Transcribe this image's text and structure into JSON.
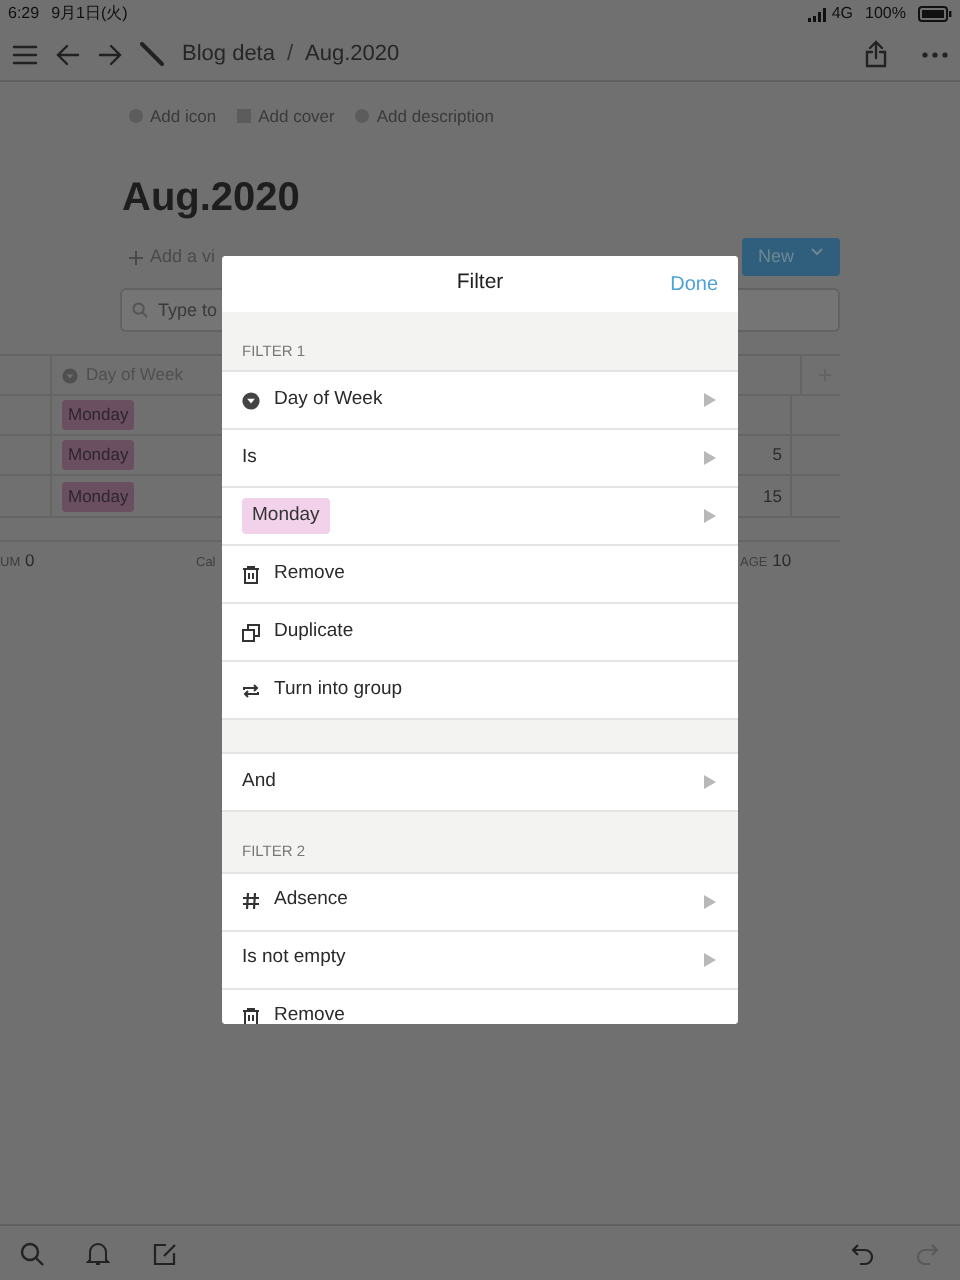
{
  "status_bar": {
    "time": "6:29",
    "date": "9月1日(火)",
    "network": "4G",
    "battery": "100%"
  },
  "nav": {
    "breadcrumb": [
      "Blog deta",
      "Aug.2020"
    ],
    "separator": "/"
  },
  "page_actions": [
    "Add icon",
    "Add cover",
    "Add description"
  ],
  "title": "Aug.2020",
  "view_bar": {
    "add_view": "Add a vi",
    "new_button": "New"
  },
  "search": {
    "placeholder": "Type to"
  },
  "table": {
    "columns": [
      "Day of Week"
    ],
    "rows": [
      {
        "day": "Monday"
      },
      {
        "day": "Monday",
        "value": "5"
      },
      {
        "day": "Monday",
        "value": "15"
      }
    ]
  },
  "footer": [
    {
      "label": "UM",
      "value": "0"
    },
    {
      "label": "Cal"
    },
    {
      "label": "AGE",
      "value": "10"
    }
  ],
  "modal": {
    "title": "Filter",
    "done": "Done",
    "sections": [
      {
        "label": "FILTER 1",
        "items": [
          {
            "kind": "property_select",
            "text": "Day of Week"
          },
          {
            "kind": "condition",
            "text": "Is"
          },
          {
            "kind": "tag",
            "text": "Monday"
          },
          {
            "kind": "remove",
            "text": "Remove"
          },
          {
            "kind": "duplicate",
            "text": "Duplicate"
          },
          {
            "kind": "group",
            "text": "Turn into group"
          }
        ]
      },
      {
        "items": [
          {
            "kind": "condition",
            "text": "And"
          }
        ]
      },
      {
        "label": "FILTER 2",
        "items": [
          {
            "kind": "property_number",
            "text": "Adsence"
          },
          {
            "kind": "condition",
            "text": "Is not empty"
          },
          {
            "kind": "remove",
            "text": "Remove"
          }
        ]
      }
    ]
  }
}
